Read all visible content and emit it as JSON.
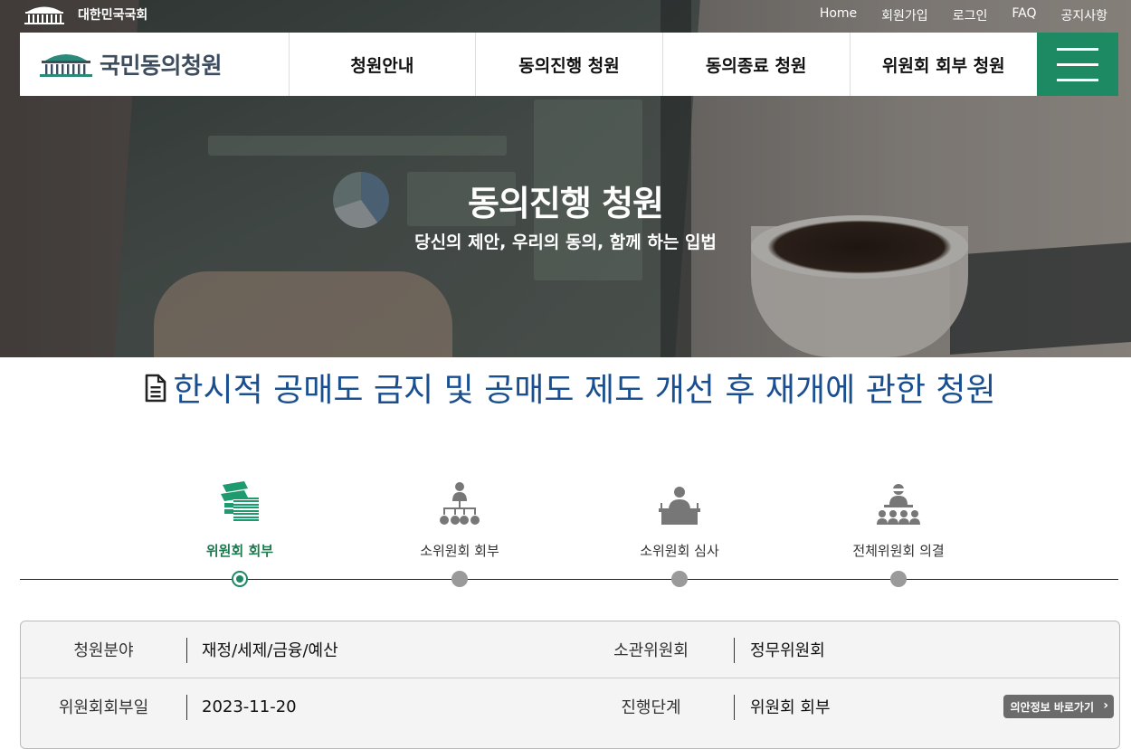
{
  "gov": {
    "name": "대한민국국회"
  },
  "util_nav": [
    "Home",
    "회원가입",
    "로그인",
    "FAQ",
    "공지사항"
  ],
  "brand": {
    "name": "국민동의청원"
  },
  "menu": [
    "청원안내",
    "동의진행 청원",
    "동의종료 청원",
    "위원회 회부 청원"
  ],
  "hero": {
    "title": "동의진행 청원",
    "subtitle": "당신의 제안, 우리의 동의, 함께 하는 입법"
  },
  "petition": {
    "title": "한시적 공매도 금지 및 공매도 제도 개선 후 재개에 관한 청원"
  },
  "steps": [
    {
      "label": "위원회 회부",
      "icon": "documents-stack-icon",
      "active": true
    },
    {
      "label": "소위원회 회부",
      "icon": "org-chart-icon",
      "active": false
    },
    {
      "label": "소위원회 심사",
      "icon": "podium-speaker-icon",
      "active": false
    },
    {
      "label": "전체위원회 의결",
      "icon": "assembly-icon",
      "active": false
    }
  ],
  "info": {
    "row1": {
      "label_a": "청원분야",
      "value_a": "재정/세제/금융/예산",
      "label_b": "소관위원회",
      "value_b": "정무위원회"
    },
    "row2": {
      "label_a": "위원회회부일",
      "value_a": "2023-11-20",
      "label_b": "진행단계",
      "value_b": "위원회 회부"
    },
    "bill_button": "의안정보 바로가기",
    "bill_button_chevron": "›"
  },
  "colors": {
    "accent_green": "#1d8a63",
    "title_blue": "#1a4f8f",
    "brand_slate": "#3d4c5e"
  }
}
